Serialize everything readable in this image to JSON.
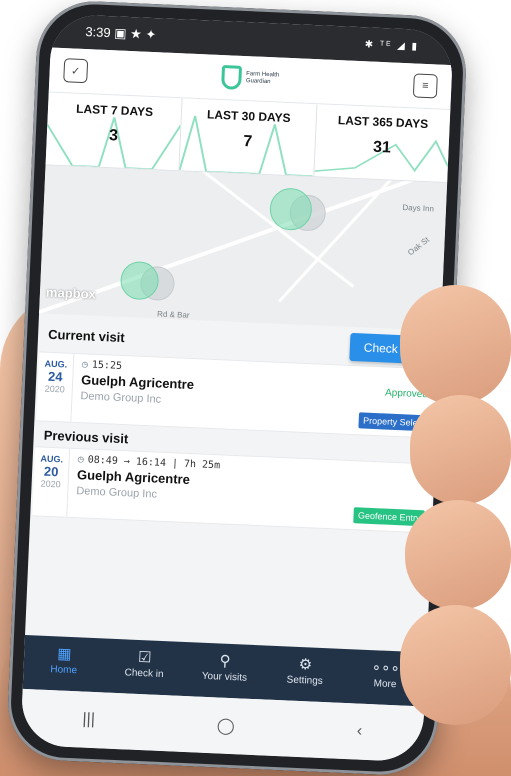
{
  "status_bar": {
    "time": "3:39",
    "left_icons": "▣ ★ ✦",
    "right_icons": "✱ ᵀᴱ ◢ ▮"
  },
  "app_bar": {
    "left_icon": "clipboard-check-icon",
    "logo_line1": "Farm Health",
    "logo_line2": "Guardian",
    "right_icon": "message-icon"
  },
  "stats": [
    {
      "label": "LAST 7 DAYS",
      "value": "3"
    },
    {
      "label": "LAST 30 DAYS",
      "value": "7"
    },
    {
      "label": "LAST 365 DAYS",
      "value": "31"
    }
  ],
  "map": {
    "label_days_inn": "Days Inn",
    "label_oak": "Oak St",
    "label_bottom": "Rd & Bar",
    "attribution": "mapbox"
  },
  "current_visit": {
    "section_title": "Current visit",
    "checkout_label": "Check out",
    "month": "AUG.",
    "day": "24",
    "year": "2020",
    "time": "15:25",
    "place": "Guelph Agricentre",
    "org": "Demo Group Inc",
    "status": "Approved",
    "badge": "Property Select"
  },
  "previous_visit": {
    "section_title": "Previous visit",
    "month": "AUG.",
    "day": "20",
    "year": "2020",
    "time": "08:49 → 16:14 | 7h 25m",
    "place": "Guelph Agricentre",
    "org": "Demo Group Inc",
    "badge": "Geofence Entry"
  },
  "bottom_nav": [
    {
      "label": "Home",
      "icon": "home-grid-icon"
    },
    {
      "label": "Check in",
      "icon": "check-in-icon"
    },
    {
      "label": "Your visits",
      "icon": "visits-icon"
    },
    {
      "label": "Settings",
      "icon": "gear-icon"
    },
    {
      "label": "More",
      "icon": "more-icon"
    }
  ],
  "colors": {
    "accent": "#2a8fe8",
    "nav_bg": "#223247",
    "success": "#27b36a",
    "brand_green": "#3dc59a"
  }
}
